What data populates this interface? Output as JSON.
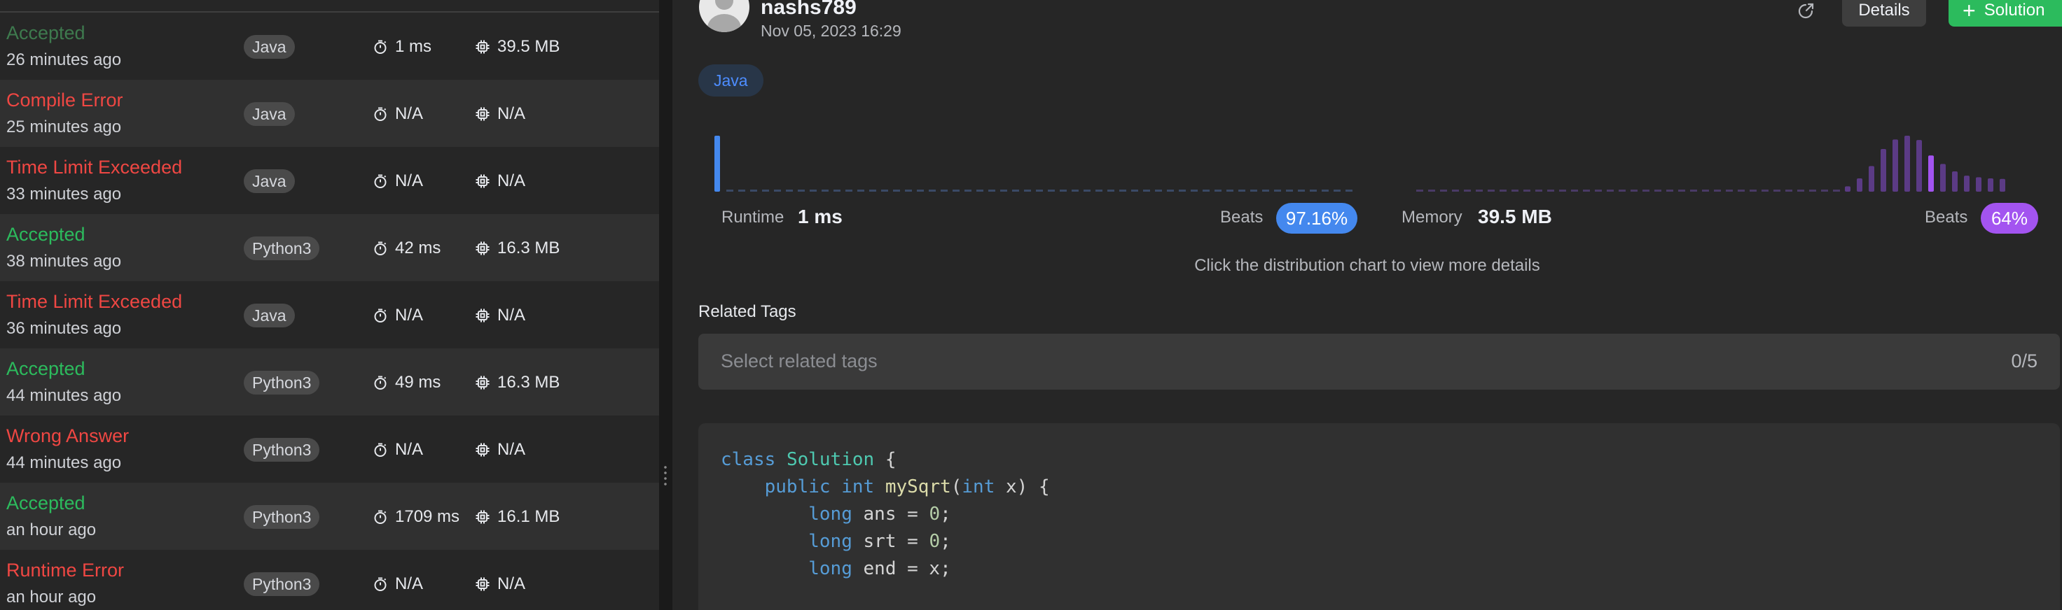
{
  "submissions": [
    {
      "status": "Accepted",
      "status_type": "ok",
      "time": "26 minutes ago",
      "language": "Java",
      "runtime": "1 ms",
      "memory": "39.5 MB"
    },
    {
      "status": "Compile Error",
      "status_type": "bad",
      "time": "25 minutes ago",
      "language": "Java",
      "runtime": "N/A",
      "memory": "N/A"
    },
    {
      "status": "Time Limit Exceeded",
      "status_type": "bad",
      "time": "33 minutes ago",
      "language": "Java",
      "runtime": "N/A",
      "memory": "N/A"
    },
    {
      "status": "Accepted",
      "status_type": "ok",
      "time": "38 minutes ago",
      "language": "Python3",
      "runtime": "42 ms",
      "memory": "16.3 MB"
    },
    {
      "status": "Time Limit Exceeded",
      "status_type": "bad",
      "time": "36 minutes ago",
      "language": "Java",
      "runtime": "N/A",
      "memory": "N/A"
    },
    {
      "status": "Accepted",
      "status_type": "ok",
      "time": "44 minutes ago",
      "language": "Python3",
      "runtime": "49 ms",
      "memory": "16.3 MB"
    },
    {
      "status": "Wrong Answer",
      "status_type": "bad",
      "time": "44 minutes ago",
      "language": "Python3",
      "runtime": "N/A",
      "memory": "N/A"
    },
    {
      "status": "Accepted",
      "status_type": "ok",
      "time": "an hour ago",
      "language": "Python3",
      "runtime": "1709 ms",
      "memory": "16.1 MB"
    },
    {
      "status": "Runtime Error",
      "status_type": "bad",
      "time": "an hour ago",
      "language": "Python3",
      "runtime": "N/A",
      "memory": "N/A"
    }
  ],
  "detail": {
    "username": "nashs789",
    "submitted_at": "Nov 05, 2023 16:29",
    "details_button": "Details",
    "solution_button": "Solution",
    "language_chip": "Java",
    "runtime_label": "Runtime",
    "runtime_value": "1 ms",
    "runtime_beats_label": "Beats",
    "runtime_beats": "97.16%",
    "memory_label": "Memory",
    "memory_value": "39.5 MB",
    "memory_beats_label": "Beats",
    "memory_beats": "64%",
    "hint": "Click the distribution chart to view more details",
    "tags_title": "Related Tags",
    "tags_placeholder": "Select related tags",
    "tags_count": "0/5"
  },
  "colors": {
    "accepted": "#2cbb5d",
    "error": "#ef4743",
    "runtime_bar": "#4488ee",
    "memory_bar": "#a354f0",
    "memory_bar_dim": "#5b3b85",
    "baseline": "#3a4a66",
    "memory_baseline": "#4a3a66"
  },
  "chart_data": [
    {
      "type": "bar",
      "name": "runtime-distribution",
      "highlight_index": 0,
      "values": [
        100,
        3,
        3,
        3,
        3,
        3,
        3,
        3,
        3,
        3,
        3,
        3,
        3,
        3,
        3,
        3,
        3,
        3,
        3,
        3,
        3,
        3,
        3,
        3,
        3,
        3,
        3,
        3,
        3,
        3,
        3,
        3,
        3,
        3,
        3,
        3,
        3,
        3,
        3,
        3,
        3,
        3,
        3,
        3,
        3,
        3,
        3,
        3,
        3,
        3,
        3,
        3,
        3,
        3,
        3
      ]
    },
    {
      "type": "bar",
      "name": "memory-distribution",
      "highlight_index": 43,
      "values": [
        3,
        3,
        3,
        3,
        3,
        3,
        3,
        3,
        3,
        3,
        3,
        3,
        3,
        3,
        3,
        3,
        3,
        3,
        3,
        3,
        3,
        3,
        3,
        3,
        3,
        3,
        3,
        3,
        3,
        3,
        3,
        3,
        3,
        3,
        3,
        3,
        10,
        25,
        48,
        80,
        98,
        105,
        97,
        68,
        52,
        38,
        30,
        27,
        25,
        24
      ]
    }
  ],
  "code": [
    [
      {
        "c": "kw",
        "t": "class"
      },
      {
        "c": "tx",
        "t": " "
      },
      {
        "c": "ty",
        "t": "Solution"
      },
      {
        "c": "tx",
        "t": " {"
      }
    ],
    [
      {
        "c": "tx",
        "t": "    "
      },
      {
        "c": "kw",
        "t": "public"
      },
      {
        "c": "tx",
        "t": " "
      },
      {
        "c": "kw",
        "t": "int"
      },
      {
        "c": "tx",
        "t": " "
      },
      {
        "c": "fn",
        "t": "mySqrt"
      },
      {
        "c": "tx",
        "t": "("
      },
      {
        "c": "kw",
        "t": "int"
      },
      {
        "c": "tx",
        "t": " x) {"
      }
    ],
    [
      {
        "c": "tx",
        "t": "        "
      },
      {
        "c": "kw",
        "t": "long"
      },
      {
        "c": "tx",
        "t": " ans = "
      },
      {
        "c": "num",
        "t": "0"
      },
      {
        "c": "tx",
        "t": ";"
      }
    ],
    [
      {
        "c": "tx",
        "t": "        "
      },
      {
        "c": "kw",
        "t": "long"
      },
      {
        "c": "tx",
        "t": " srt = "
      },
      {
        "c": "num",
        "t": "0"
      },
      {
        "c": "tx",
        "t": ";"
      }
    ],
    [
      {
        "c": "tx",
        "t": "        "
      },
      {
        "c": "kw",
        "t": "long"
      },
      {
        "c": "tx",
        "t": " end = x;"
      }
    ]
  ]
}
